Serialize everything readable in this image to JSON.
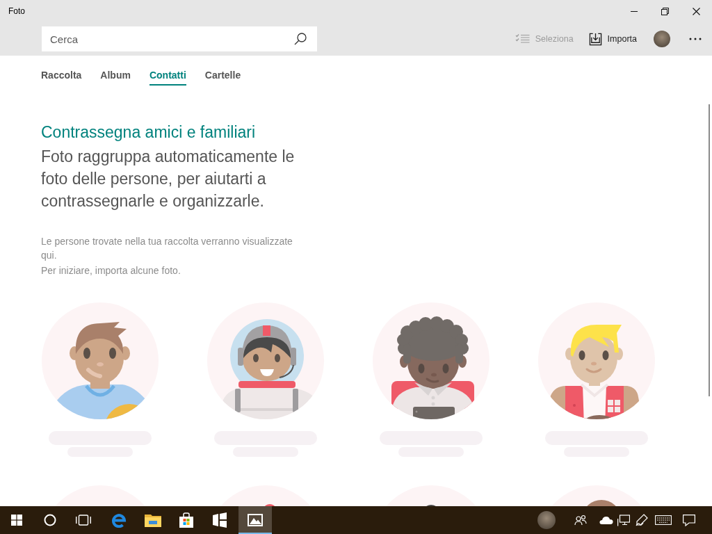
{
  "window": {
    "title": "Foto"
  },
  "toolbar": {
    "search": {
      "placeholder": "Cerca"
    },
    "actions": [
      {
        "kind": "select",
        "label": "Seleziona",
        "disabled": true
      },
      {
        "kind": "import",
        "label": "Importa",
        "disabled": false
      }
    ]
  },
  "tabs": [
    {
      "label": "Raccolta",
      "selected": false
    },
    {
      "label": "Album",
      "selected": false
    },
    {
      "label": "Contatti",
      "selected": true
    },
    {
      "label": "Cartelle",
      "selected": false
    }
  ],
  "intro": {
    "title": "Contrassegna amici e familiari",
    "body": "Foto raggruppa automaticamente le foto delle persone, per aiutarti a contrassegnarle e organizzarle.",
    "notes": [
      "Le persone trovate nella tua raccolta verranno visualizzate qui.",
      "Per iniziare, importa alcune foto."
    ]
  },
  "people": [
    {
      "kind": "boy"
    },
    {
      "kind": "astronaut"
    },
    {
      "kind": "curly"
    },
    {
      "kind": "blond"
    },
    {
      "kind": "bare"
    },
    {
      "kind": "redtop"
    },
    {
      "kind": "darktop"
    },
    {
      "kind": "browntop"
    }
  ],
  "taskbar": {
    "apps": [
      {
        "kind": "start",
        "selected": false
      },
      {
        "kind": "cortana",
        "selected": false
      },
      {
        "kind": "taskview",
        "selected": false
      },
      {
        "kind": "browser",
        "selected": false
      },
      {
        "kind": "explorer",
        "selected": false
      },
      {
        "kind": "store",
        "selected": false
      },
      {
        "kind": "panels",
        "selected": false
      },
      {
        "kind": "photos",
        "selected": true
      }
    ],
    "tray": [
      {
        "kind": "avatar"
      },
      {
        "kind": "people"
      },
      {
        "kind": "cloud"
      },
      {
        "kind": "network"
      },
      {
        "kind": "pen"
      },
      {
        "kind": "keyboard"
      },
      {
        "kind": "notifications"
      }
    ]
  }
}
